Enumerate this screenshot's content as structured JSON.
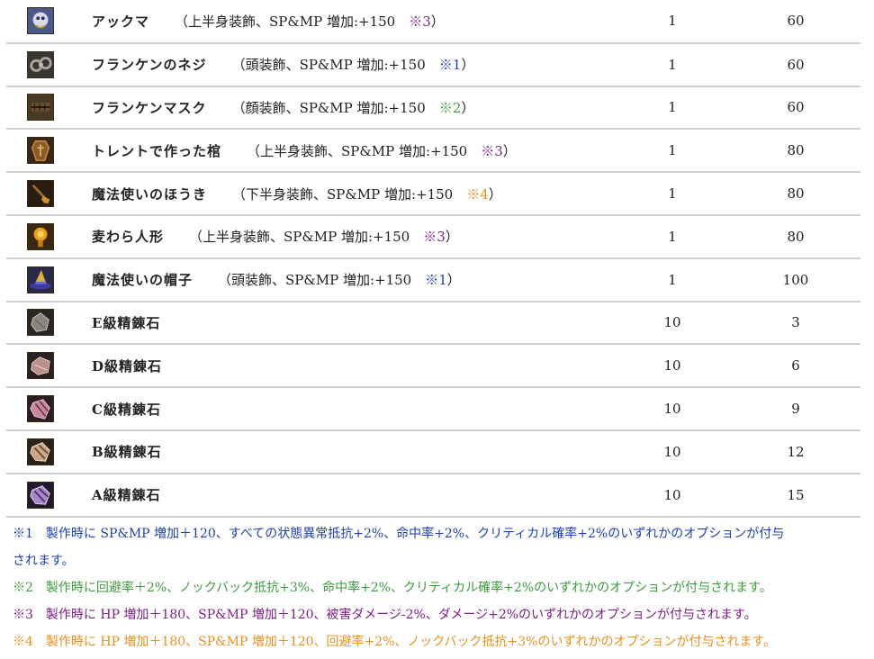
{
  "items": [
    {
      "icon": "akkuma-icon",
      "name": "アックマ",
      "detail": "（上半身装飾、SP&MP 増加:+150",
      "mark": "※3",
      "close": "）",
      "mark_class": "m3",
      "qty": "1",
      "price": "60"
    },
    {
      "icon": "frankenstein-bolt-icon",
      "name": "フランケンのネジ",
      "detail": "（頭装飾、SP&MP 増加:+150",
      "mark": "※1",
      "close": "）",
      "mark_class": "m1",
      "qty": "1",
      "price": "60"
    },
    {
      "icon": "frankenstein-mask-icon",
      "name": "フランケンマスク",
      "detail": "（顔装飾、SP&MP 増加:+150",
      "mark": "※2",
      "close": "）",
      "mark_class": "m2",
      "qty": "1",
      "price": "60"
    },
    {
      "icon": "treant-coffin-icon",
      "name": "トレントで作った棺",
      "detail": "（上半身装飾、SP&MP 増加:+150",
      "mark": "※3",
      "close": "）",
      "mark_class": "m3",
      "qty": "1",
      "price": "80"
    },
    {
      "icon": "witch-broom-icon",
      "name": "魔法使いのほうき",
      "detail": "（下半身装飾、SP&MP 増加:+150",
      "mark": "※4",
      "close": "）",
      "mark_class": "m4",
      "qty": "1",
      "price": "80"
    },
    {
      "icon": "straw-doll-icon",
      "name": "麦わら人形",
      "detail": "（上半身装飾、SP&MP 増加:+150",
      "mark": "※3",
      "close": "）",
      "mark_class": "m3",
      "qty": "1",
      "price": "80"
    },
    {
      "icon": "witch-hat-icon",
      "name": "魔法使いの帽子",
      "detail": "（頭装飾、SP&MP 増加:+150",
      "mark": "※1",
      "close": "）",
      "mark_class": "m1",
      "qty": "1",
      "price": "100"
    },
    {
      "icon": "e-refining-stone-icon",
      "name": "E級精錬石",
      "detail": "",
      "mark": "",
      "close": "",
      "mark_class": "",
      "qty": "10",
      "price": "3"
    },
    {
      "icon": "d-refining-stone-icon",
      "name": "D級精錬石",
      "detail": "",
      "mark": "",
      "close": "",
      "mark_class": "",
      "qty": "10",
      "price": "6"
    },
    {
      "icon": "c-refining-stone-icon",
      "name": "C級精錬石",
      "detail": "",
      "mark": "",
      "close": "",
      "mark_class": "",
      "qty": "10",
      "price": "9"
    },
    {
      "icon": "b-refining-stone-icon",
      "name": "B級精錬石",
      "detail": "",
      "mark": "",
      "close": "",
      "mark_class": "",
      "qty": "10",
      "price": "12"
    },
    {
      "icon": "a-refining-stone-icon",
      "name": "A級精錬石",
      "detail": "",
      "mark": "",
      "close": "",
      "mark_class": "",
      "qty": "10",
      "price": "15"
    }
  ],
  "notes": {
    "n1_line1": "※1　製作時に SP&MP 増加＋120、すべての状態異常抵抗+2%、命中率+2%、クリティカル確率+2%のいずれかのオプションが付与",
    "n1_line2": "されます。",
    "n2": "※2　製作時に回避率＋2%、ノックバック抵抗+3%、命中率+2%、クリティカル確率+2%のいずれかのオプションが付与されます。",
    "n3": "※3　製作時に HP 増加＋180、SP&MP 増加＋120、被害ダメージ-2%、ダメージ+2%のいずれかのオプションが付与されます。",
    "n4": "※4　製作時に HP 増加＋180、SP&MP 増加＋120、回避率+2%、ノックバック抵抗+3%のいずれかのオプションが付与されます。"
  },
  "colors": {
    "m1": "#1f3fb0",
    "m2": "#3e9a3e",
    "m3": "#7d1f86",
    "m4": "#e8901c",
    "row_border": "#cfcfcf"
  }
}
